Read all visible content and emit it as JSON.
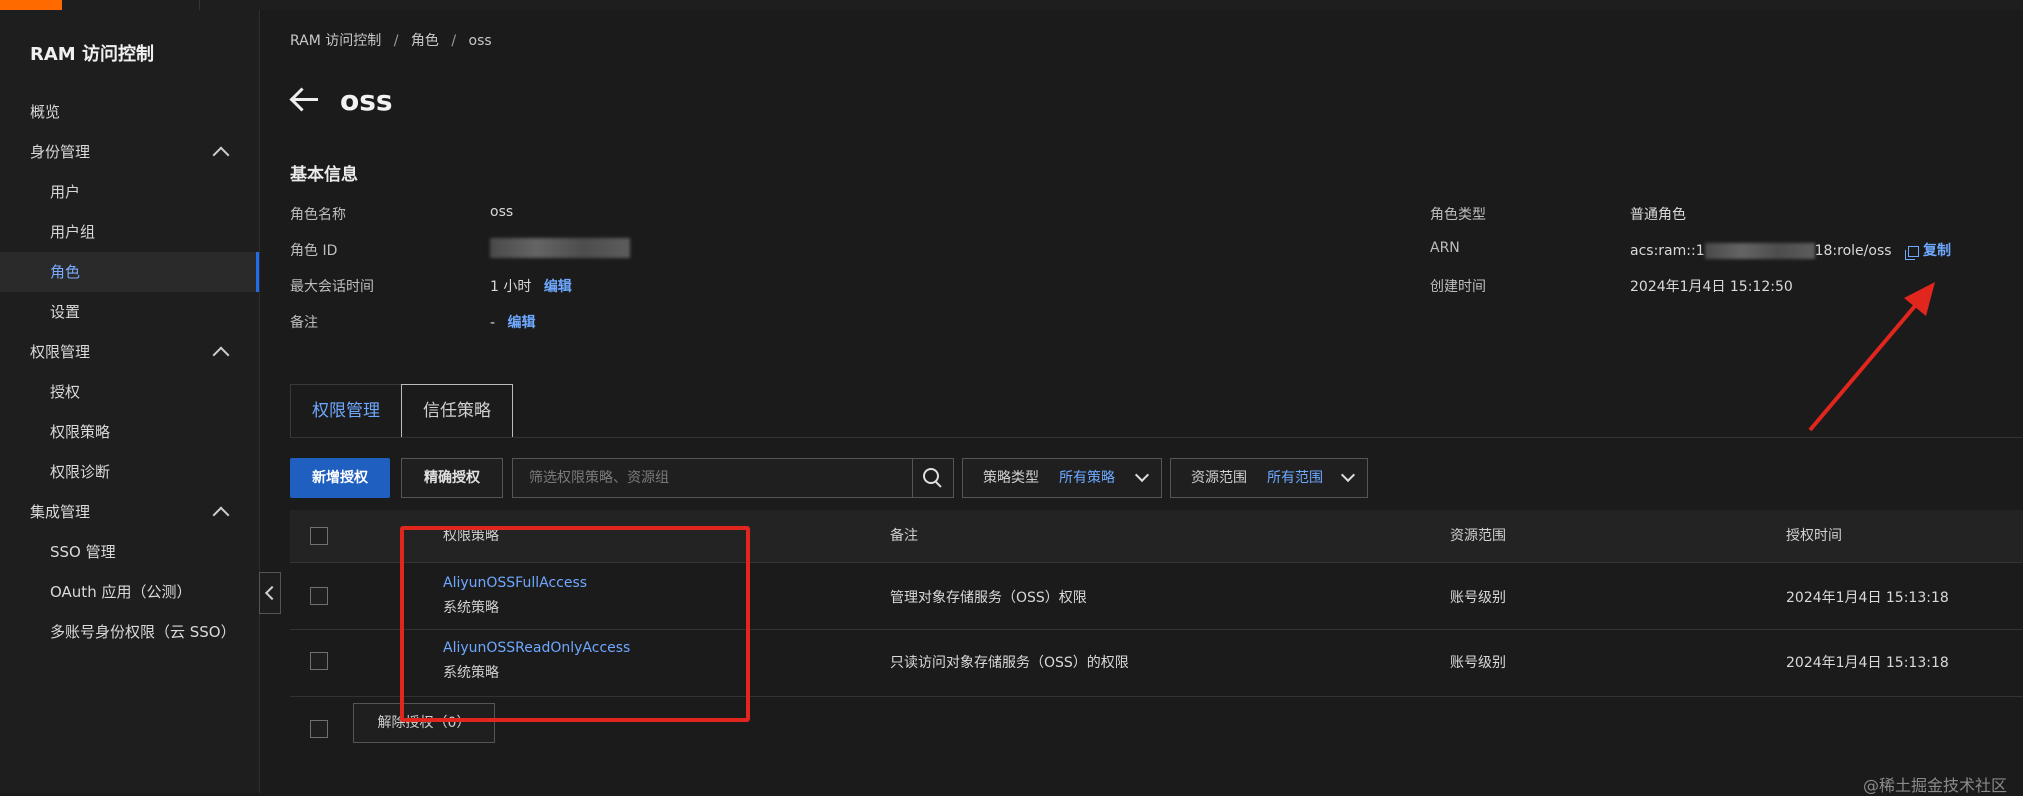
{
  "sidebar": {
    "title": "RAM 访问控制",
    "items": [
      {
        "label": "概览"
      },
      {
        "label": "身份管理"
      },
      {
        "label": "用户"
      },
      {
        "label": "用户组"
      },
      {
        "label": "角色"
      },
      {
        "label": "设置"
      },
      {
        "label": "权限管理"
      },
      {
        "label": "授权"
      },
      {
        "label": "权限策略"
      },
      {
        "label": "权限诊断"
      },
      {
        "label": "集成管理"
      },
      {
        "label": "SSO 管理"
      },
      {
        "label": "OAuth 应用（公测）"
      },
      {
        "label": "多账号身份权限（云 SSO）"
      }
    ]
  },
  "breadcrumb": [
    "RAM 访问控制",
    "/",
    "角色",
    "/",
    "oss"
  ],
  "page_title": "oss",
  "basic_info": {
    "title": "基本信息",
    "left": {
      "role_name_label": "角色名称",
      "role_name_value": "oss",
      "role_id_label": "角色 ID",
      "max_session_label": "最大会话时间",
      "max_session_value": "1 小时",
      "remark_label": "备注",
      "remark_value": "-",
      "edit_label": "编辑"
    },
    "right": {
      "role_type_label": "角色类型",
      "role_type_value": "普通角色",
      "arn_label": "ARN",
      "arn_prefix": "acs:ram::1",
      "arn_suffix": "18:role/oss",
      "copy_label": "复制",
      "created_label": "创建时间",
      "created_value": "2024年1月4日 15:12:50"
    }
  },
  "tabs": {
    "permissions": "权限管理",
    "trust": "信任策略"
  },
  "toolbar": {
    "add_label": "新增授权",
    "precise_label": "精确授权",
    "search_placeholder": "筛选权限策略、资源组",
    "policy_type_label": "策略类型",
    "policy_type_value": "所有策略",
    "scope_label": "资源范围",
    "scope_value": "所有范围"
  },
  "table": {
    "headers": {
      "policy": "权限策略",
      "remark": "备注",
      "scope": "资源范围",
      "time": "授权时间"
    },
    "rows": [
      {
        "policy": "AliyunOSSFullAccess",
        "type": "系统策略",
        "remark": "管理对象存储服务（OSS）权限",
        "scope": "账号级别",
        "time": "2024年1月4日 15:13:18"
      },
      {
        "policy": "AliyunOSSReadOnlyAccess",
        "type": "系统策略",
        "remark": "只读访问对象存储服务（OSS）的权限",
        "scope": "账号级别",
        "time": "2024年1月4日 15:13:18"
      }
    ],
    "revoke_label": "解除授权（0）"
  },
  "watermark": "@稀土掘金技术社区",
  "colors": {
    "accent": "#1f5fbf",
    "link": "#6ea8ff",
    "annotation": "#e0261d",
    "brand": "#ff6a00"
  }
}
